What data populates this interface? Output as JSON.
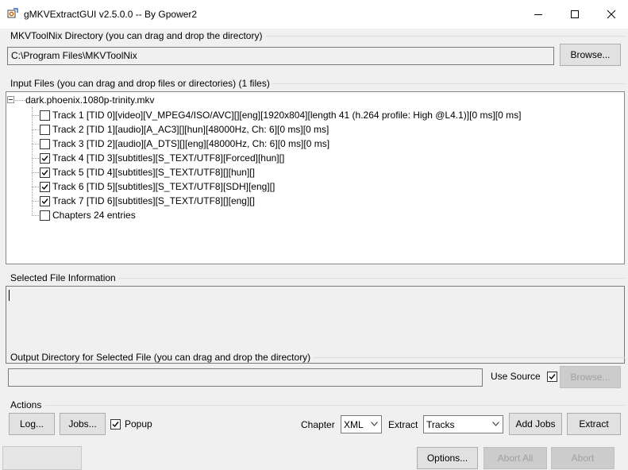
{
  "window": {
    "title": "gMKVExtractGUI v2.5.0.0 -- By Gpower2",
    "minimize_glyph": "—",
    "maximize_glyph": "☐",
    "close_glyph": "✕"
  },
  "mkvtoolnix": {
    "label": "MKVToolNix Directory (you can drag and drop the directory)",
    "path": "C:\\Program Files\\MKVToolNix",
    "browse_label": "Browse..."
  },
  "input_files": {
    "label": "Input Files (you can drag and drop files or directories) (1 files)",
    "file_name": "dark.phoenix.1080p-trinity.mkv",
    "tracks": [
      {
        "label": "Track 1 [TID 0][video][V_MPEG4/ISO/AVC][][eng][1920x804][length 41 (h.264 profile: High @L4.1)][0 ms][0 ms]",
        "checked": false
      },
      {
        "label": "Track 2 [TID 1][audio][A_AC3][][hun][48000Hz, Ch: 6][0 ms][0 ms]",
        "checked": false
      },
      {
        "label": "Track 3 [TID 2][audio][A_DTS][][eng][48000Hz, Ch: 6][0 ms][0 ms]",
        "checked": false
      },
      {
        "label": "Track 4 [TID 3][subtitles][S_TEXT/UTF8][Forced][hun][]",
        "checked": true
      },
      {
        "label": "Track 5 [TID 4][subtitles][S_TEXT/UTF8][][hun][]",
        "checked": true
      },
      {
        "label": "Track 6 [TID 5][subtitles][S_TEXT/UTF8][SDH][eng][]",
        "checked": true
      },
      {
        "label": "Track 7 [TID 6][subtitles][S_TEXT/UTF8][][eng][]",
        "checked": true
      },
      {
        "label": "Chapters 24 entries",
        "checked": false
      }
    ]
  },
  "selected_info": {
    "label": "Selected File Information",
    "value": ""
  },
  "output": {
    "label": "Output Directory for Selected File (you can drag and drop the directory)",
    "path": "",
    "use_source_label": "Use Source",
    "use_source_checked": true,
    "browse_label": "Browse..."
  },
  "actions": {
    "label": "Actions",
    "log_label": "Log...",
    "jobs_label": "Jobs...",
    "popup_label": "Popup",
    "popup_checked": true,
    "chapter_label": "Chapter",
    "chapter_value": "XML",
    "extract_label": "Extract",
    "extract_value": "Tracks",
    "add_jobs_label": "Add Jobs",
    "extract_button_label": "Extract"
  },
  "statusbar": {
    "options_label": "Options...",
    "abort_all_label": "Abort All",
    "abort_label": "Abort"
  },
  "colors": {
    "background": "#f0f0f0",
    "disabled_text": "#a0a0a0"
  }
}
